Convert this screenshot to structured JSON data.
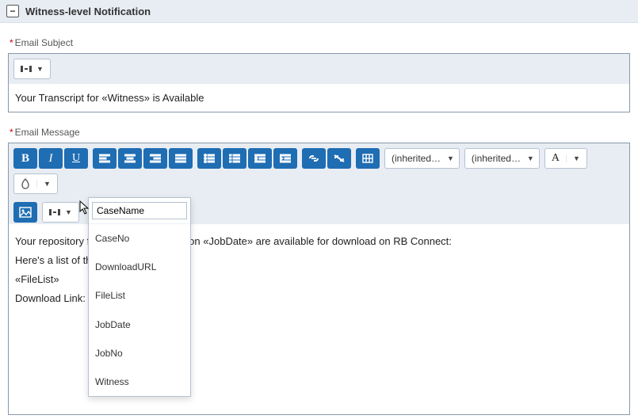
{
  "section": {
    "title": "Witness-level Notification"
  },
  "subject": {
    "label": "Email Subject",
    "value": "Your Transcript for «Witness» is Available"
  },
  "message": {
    "label": "Email Message",
    "font_family_display": "(inherited f...",
    "font_size_display": "(inherited s...",
    "text_color_label": "A",
    "body_lines": [
      "Your repository files for «CaseName» on «JobDate» are available for download on RB Connect:",
      "Here's a list of the files:",
      "«FileList»",
      "Download Link:"
    ]
  },
  "merge_field_dropdown": {
    "input_value": "CaseName",
    "items": [
      "CaseNo",
      "DownloadURL",
      "FileList",
      "JobDate",
      "JobNo",
      "Witness"
    ]
  }
}
